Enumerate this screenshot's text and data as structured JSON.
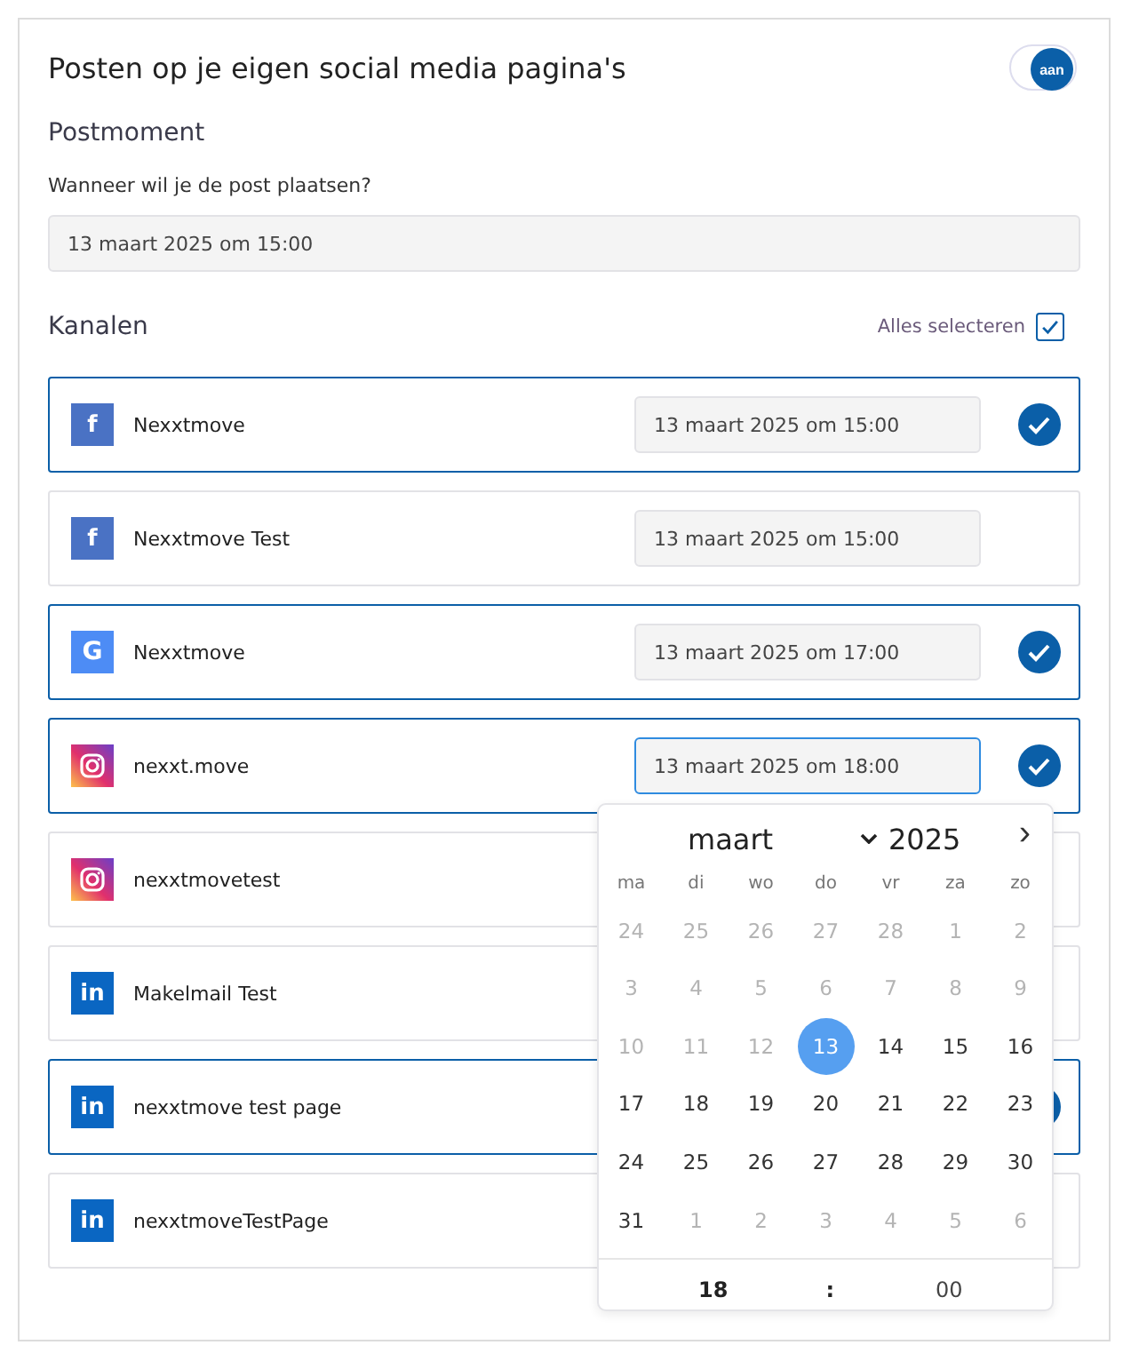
{
  "header": {
    "title": "Posten op je eigen social media pagina's",
    "toggle": {
      "label": "aan",
      "on": true
    }
  },
  "postmoment": {
    "heading": "Postmoment",
    "question": "Wanneer wil je de post plaatsen?",
    "value": "13 maart 2025 om 15:00"
  },
  "channels_section": {
    "heading": "Kanalen",
    "select_all": {
      "label": "Alles selecteren",
      "checked": true
    }
  },
  "channels": [
    {
      "kind": "facebook",
      "glyph": "f",
      "name": "Nexxtmove",
      "date": "13 maart 2025 om 15:00",
      "selected": true,
      "focused": false
    },
    {
      "kind": "facebook",
      "glyph": "f",
      "name": "Nexxtmove Test",
      "date": "13 maart 2025 om 15:00",
      "selected": false,
      "focused": false
    },
    {
      "kind": "google",
      "glyph": "G",
      "name": "Nexxtmove",
      "date": "13 maart 2025 om 17:00",
      "selected": true,
      "focused": false
    },
    {
      "kind": "instagram",
      "name": "nexxt.move",
      "date": "13 maart 2025 om 18:00",
      "selected": true,
      "focused": true
    },
    {
      "kind": "instagram",
      "name": "nexxtmovetest",
      "selected": false
    },
    {
      "kind": "linkedin",
      "glyph": "in",
      "name": "Makelmail Test",
      "selected": false
    },
    {
      "kind": "linkedin",
      "glyph": "in",
      "name": "nexxtmove test page",
      "selected": true
    },
    {
      "kind": "linkedin",
      "glyph": "in",
      "name": "nexxtmoveTestPage",
      "selected": false
    }
  ],
  "date_picker": {
    "month": "maart",
    "year": "2025",
    "next": "›",
    "weekdays": [
      "ma",
      "di",
      "wo",
      "do",
      "vr",
      "za",
      "zo"
    ],
    "days": [
      {
        "text": "24",
        "muted": true,
        "selected": false
      },
      {
        "text": "25",
        "muted": true,
        "selected": false
      },
      {
        "text": "26",
        "muted": true,
        "selected": false
      },
      {
        "text": "27",
        "muted": true,
        "selected": false
      },
      {
        "text": "28",
        "muted": true,
        "selected": false
      },
      {
        "text": "1",
        "muted": true,
        "selected": false
      },
      {
        "text": "2",
        "muted": true,
        "selected": false
      },
      {
        "text": "3",
        "muted": true,
        "selected": false
      },
      {
        "text": "4",
        "muted": true,
        "selected": false
      },
      {
        "text": "5",
        "muted": true,
        "selected": false
      },
      {
        "text": "6",
        "muted": true,
        "selected": false
      },
      {
        "text": "7",
        "muted": true,
        "selected": false
      },
      {
        "text": "8",
        "muted": true,
        "selected": false
      },
      {
        "text": "9",
        "muted": true,
        "selected": false
      },
      {
        "text": "10",
        "muted": true,
        "selected": false
      },
      {
        "text": "11",
        "muted": true,
        "selected": false
      },
      {
        "text": "12",
        "muted": true,
        "selected": false
      },
      {
        "text": "13",
        "muted": false,
        "selected": true
      },
      {
        "text": "14",
        "muted": false,
        "selected": false
      },
      {
        "text": "15",
        "muted": false,
        "selected": false
      },
      {
        "text": "16",
        "muted": false,
        "selected": false
      },
      {
        "text": "17",
        "muted": false,
        "selected": false
      },
      {
        "text": "18",
        "muted": false,
        "selected": false
      },
      {
        "text": "19",
        "muted": false,
        "selected": false
      },
      {
        "text": "20",
        "muted": false,
        "selected": false
      },
      {
        "text": "21",
        "muted": false,
        "selected": false
      },
      {
        "text": "22",
        "muted": false,
        "selected": false
      },
      {
        "text": "23",
        "muted": false,
        "selected": false
      },
      {
        "text": "24",
        "muted": false,
        "selected": false
      },
      {
        "text": "25",
        "muted": false,
        "selected": false
      },
      {
        "text": "26",
        "muted": false,
        "selected": false
      },
      {
        "text": "27",
        "muted": false,
        "selected": false
      },
      {
        "text": "28",
        "muted": false,
        "selected": false
      },
      {
        "text": "29",
        "muted": false,
        "selected": false
      },
      {
        "text": "30",
        "muted": false,
        "selected": false
      },
      {
        "text": "31",
        "muted": false,
        "selected": false
      },
      {
        "text": "1",
        "muted": true,
        "selected": false
      },
      {
        "text": "2",
        "muted": true,
        "selected": false
      },
      {
        "text": "3",
        "muted": true,
        "selected": false
      },
      {
        "text": "4",
        "muted": true,
        "selected": false
      },
      {
        "text": "5",
        "muted": true,
        "selected": false
      },
      {
        "text": "6",
        "muted": true,
        "selected": false
      }
    ],
    "hour": "18",
    "separator": ":",
    "minute": "00"
  }
}
